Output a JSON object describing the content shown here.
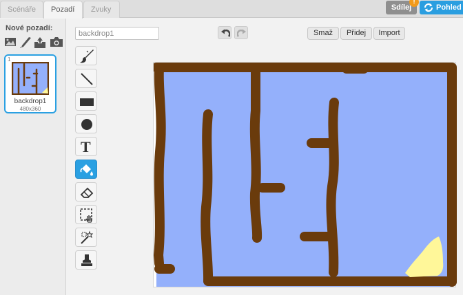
{
  "tabs": {
    "scripts": "Scénáře",
    "backdrops": "Pozadí",
    "sounds": "Zvuky"
  },
  "header": {
    "share_label": "Sdílej",
    "warning_mark": "!",
    "view_label": "Pohled"
  },
  "sidebar": {
    "new_backdrop_label": "Nové pozadí:",
    "new_backdrop_icons": [
      "image-library-icon",
      "paint-brush-icon",
      "upload-icon",
      "camera-icon"
    ],
    "backdrops": [
      {
        "number": "1",
        "name": "backdrop1",
        "size": "480x360"
      }
    ]
  },
  "editor": {
    "backdrop_name": "backdrop1",
    "clear_label": "Smaž",
    "add_label": "Přidej",
    "import_label": "Import",
    "tools": [
      "brush-tool",
      "line-tool",
      "rectangle-tool",
      "ellipse-tool",
      "text-tool",
      "fill-tool",
      "eraser-tool",
      "select-tool",
      "select-and-duplicate-tool",
      "stamp-tool"
    ],
    "selected_tool": "fill-tool",
    "text_tool_glyph": "T"
  },
  "colors": {
    "accent": "#2aa0e2",
    "maze_wall": "#6a3b0c",
    "maze_floor": "#94b0fb",
    "goal": "#fff799",
    "share_button": "#8f8f8f",
    "warning": "#f29a1a"
  }
}
